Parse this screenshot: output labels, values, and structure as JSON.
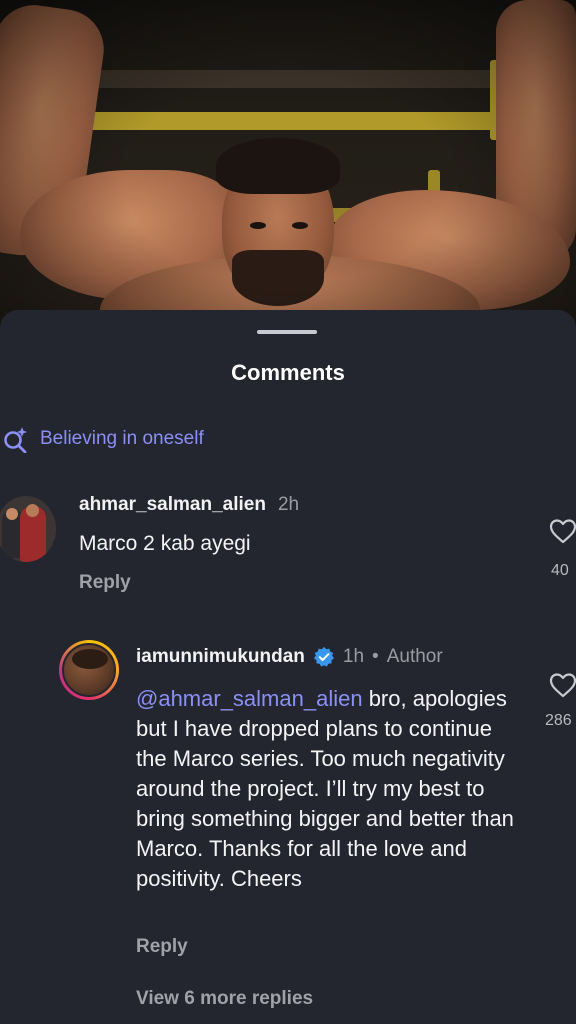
{
  "sheet": {
    "title": "Comments"
  },
  "search_suggestion": {
    "icon": "sparkle-search-icon",
    "text": "Believing in oneself",
    "color": "#8c8ff5"
  },
  "comments": [
    {
      "username": "ahmar_salman_alien",
      "time": "2h",
      "text": "Marco 2 kab ayegi",
      "reply_label": "Reply",
      "like_icon": "heart-outline-icon",
      "like_count": "40"
    }
  ],
  "replies": [
    {
      "username": "iamunnimukundan",
      "verified_icon": "verified-badge-icon",
      "time": "1h",
      "separator": "•",
      "author_tag": "Author",
      "mention": "@ahmar_salman_alien",
      "text": " bro, apologies but I have dropped plans to continue the Marco series. Too much negativity around the project. I’ll try my best to bring something bigger and better than Marco. Thanks for all the love and positivity. Cheers",
      "reply_label": "Reply",
      "like_icon": "heart-outline-icon",
      "like_count": "286",
      "more_replies_label": "View 6 more replies"
    }
  ],
  "colors": {
    "sheet_background": "#23252f",
    "mention": "#8c8ff5",
    "verified": "#3897f0"
  }
}
